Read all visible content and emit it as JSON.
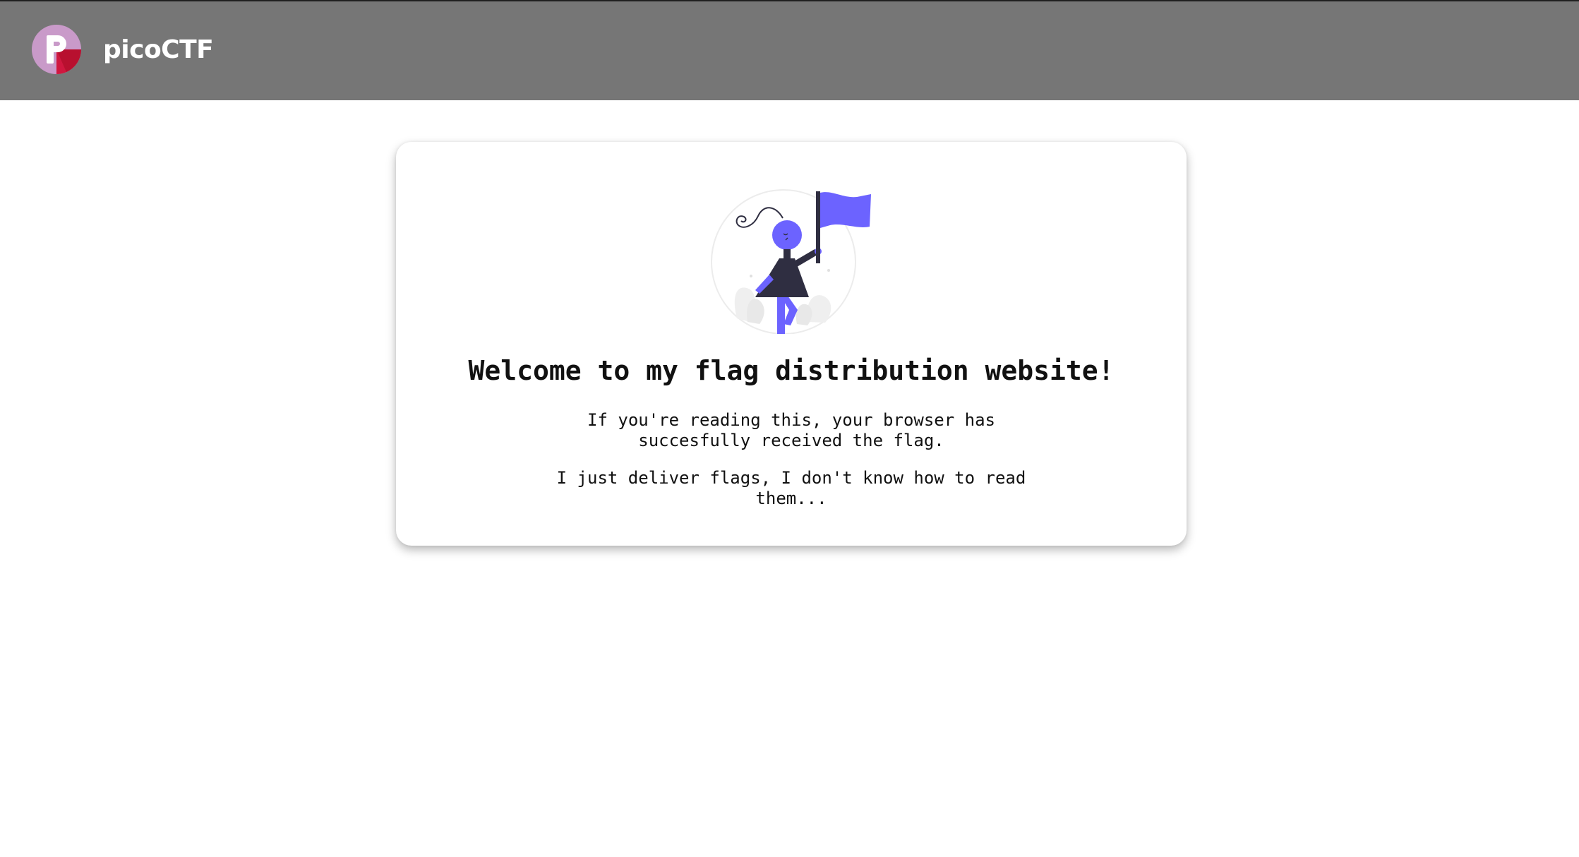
{
  "header": {
    "brand_name": "picoCTF",
    "logo_icon": "picoctf-logo-icon",
    "background_color": "#767676"
  },
  "main": {
    "illustration_icon": "person-holding-flag-illustration",
    "accent_color": "#6c63ff",
    "heading": "Welcome to my flag distribution website!",
    "paragraph_1": "If you're reading this, your browser has succesfully received the flag.",
    "paragraph_2": "I just deliver flags, I don't know how to read them..."
  }
}
